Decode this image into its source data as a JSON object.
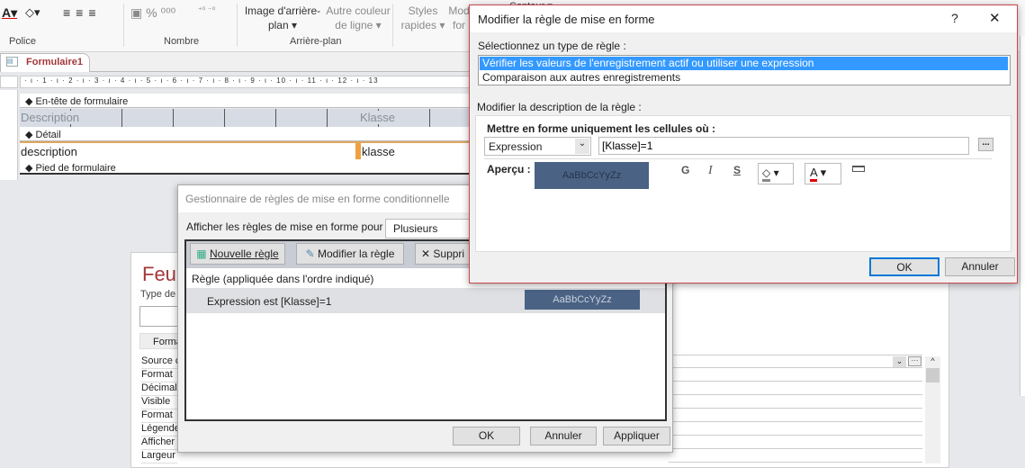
{
  "ribbon": {
    "groups": [
      "Police",
      "Nombre",
      "Arrière-plan"
    ],
    "background_image": [
      "Image d'arrière-",
      "plan ▾"
    ],
    "alt_line_color": [
      "Autre couleur",
      "de ligne ▾"
    ],
    "quick_styles": [
      "Styles",
      "rapides ▾"
    ],
    "modify": [
      "Mod",
      "for"
    ],
    "contour": "Contour ▾"
  },
  "document_tab": "Formulaire1",
  "ruler": "· ı · 1 · ı · 2 · ı · 3 · ı · 4 · ı · 5 · ı · 6 · ı · 7 · ı · 8 · ı · 9 · ı · 10 · ı · 11 · ı · 12 · ı · 13",
  "form": {
    "sections": [
      "En-tête de formulaire",
      "Détail",
      "Pied de formulaire"
    ],
    "header_labels": [
      "Description",
      "Klasse"
    ],
    "detail_fields": [
      "description",
      "klasse"
    ]
  },
  "property_sheet": {
    "title": "Feuil",
    "type_label": "Type de s",
    "tab": "Forma",
    "rows": [
      "Source c",
      "Format",
      "Décimal",
      "Visible",
      "Format",
      "Légende",
      "Afficher",
      "Largeur"
    ]
  },
  "manager": {
    "title": "Gestionnaire de règles de mise en forme conditionnelle",
    "show_for_label": "Afficher les règles de mise en forme pour :",
    "show_for_value": "Plusieurs",
    "new_rule": "Nouvelle règle",
    "edit_rule": "Modifier la règle",
    "delete_rule": "Suppri",
    "column_header": "Règle (appliquée dans l'ordre indiqué)",
    "rules": [
      {
        "text": "Expression est [Klasse]=1",
        "preview": "AaBbCcYyZz"
      }
    ],
    "ok": "OK",
    "cancel": "Annuler",
    "apply": "Appliquer"
  },
  "edit": {
    "title": "Modifier la règle de mise en forme",
    "help": "?",
    "close": "✕",
    "select_type_label": "Sélectionnez un type de règle :",
    "types": [
      "Vérifier les valeurs de l'enregistrement actif ou utiliser une expression",
      "Comparaison aux autres enregistrements"
    ],
    "selected_type": 0,
    "desc_label": "Modifier la description de la règle :",
    "format_only_label": "Mettre en forme uniquement les cellules où :",
    "condition_type": "Expression",
    "expression": "[Klasse]=1",
    "builder": "...",
    "preview_label": "Aperçu :",
    "preview_text": "AaBbCcYyZz",
    "bold": "G",
    "italic": "I",
    "underline": "S",
    "ok": "OK",
    "cancel": "Annuler"
  },
  "colors": {
    "preview_bg": "#4a6284",
    "selection": "#3399ff",
    "dialog_border": "#c8464e",
    "tab_text": "#a4373a",
    "font_color": "#e00000"
  }
}
